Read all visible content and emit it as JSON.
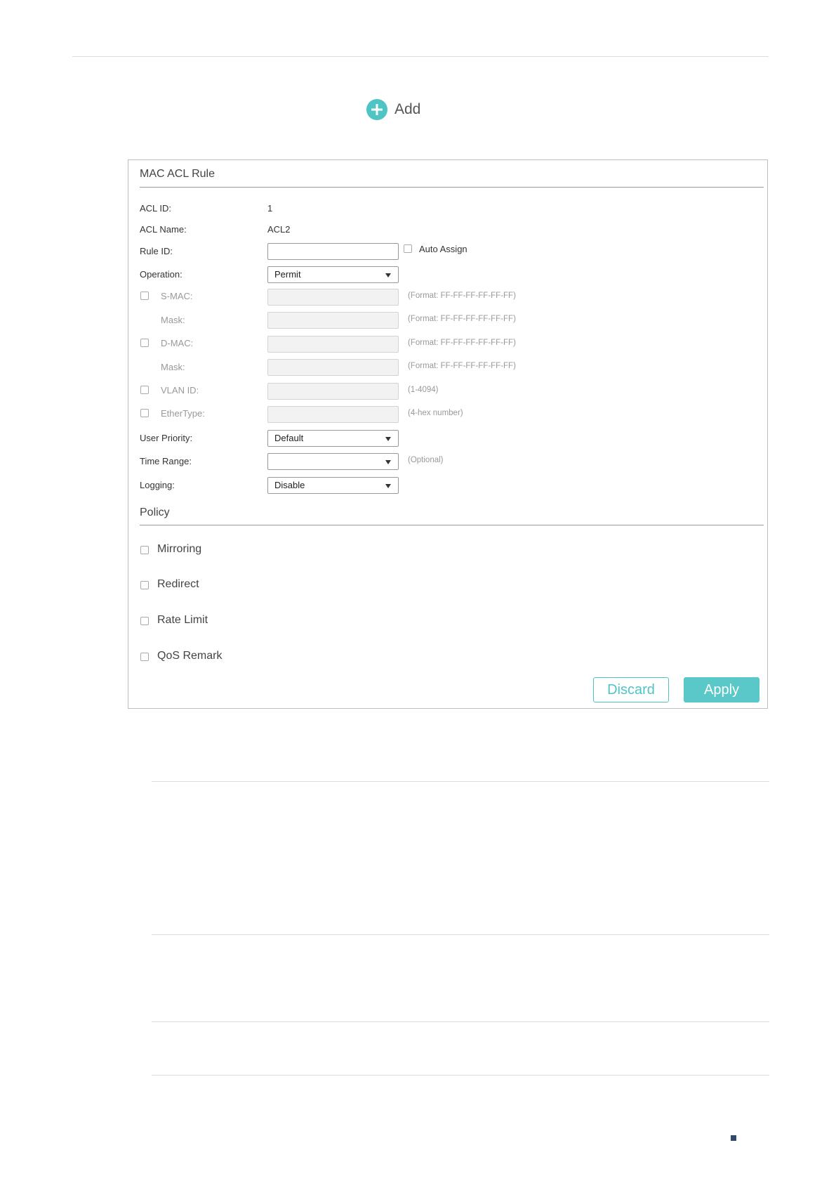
{
  "add": {
    "label": "Add",
    "icon": "plus-circle-icon",
    "accent": "#4fc4c4"
  },
  "panel": {
    "title": "MAC ACL Rule",
    "acl_id": {
      "label": "ACL ID:",
      "value": "1"
    },
    "acl_name": {
      "label": "ACL Name:",
      "value": "ACL2"
    },
    "rule_id": {
      "label": "Rule ID:",
      "value": "",
      "auto_assign_label": "Auto Assign"
    },
    "operation": {
      "label": "Operation:",
      "value": "Permit"
    },
    "s_mac": {
      "label": "S-MAC:",
      "value": "",
      "hint": "(Format: FF-FF-FF-FF-FF-FF)"
    },
    "s_mac_mask": {
      "label": "Mask:",
      "value": "",
      "hint": "(Format: FF-FF-FF-FF-FF-FF)"
    },
    "d_mac": {
      "label": "D-MAC:",
      "value": "",
      "hint": "(Format: FF-FF-FF-FF-FF-FF)"
    },
    "d_mac_mask": {
      "label": "Mask:",
      "value": "",
      "hint": "(Format: FF-FF-FF-FF-FF-FF)"
    },
    "vlan_id": {
      "label": "VLAN ID:",
      "value": "",
      "hint": "(1-4094)"
    },
    "ether_type": {
      "label": "EtherType:",
      "value": "",
      "hint": "(4-hex number)"
    },
    "user_priority": {
      "label": "User Priority:",
      "value": "Default"
    },
    "time_range": {
      "label": "Time Range:",
      "value": "",
      "hint": "(Optional)"
    },
    "logging": {
      "label": "Logging:",
      "value": "Disable"
    }
  },
  "policy": {
    "title": "Policy",
    "items": [
      "Mirroring",
      "Redirect",
      "Rate Limit",
      "QoS Remark"
    ]
  },
  "buttons": {
    "discard": "Discard",
    "apply": "Apply"
  }
}
